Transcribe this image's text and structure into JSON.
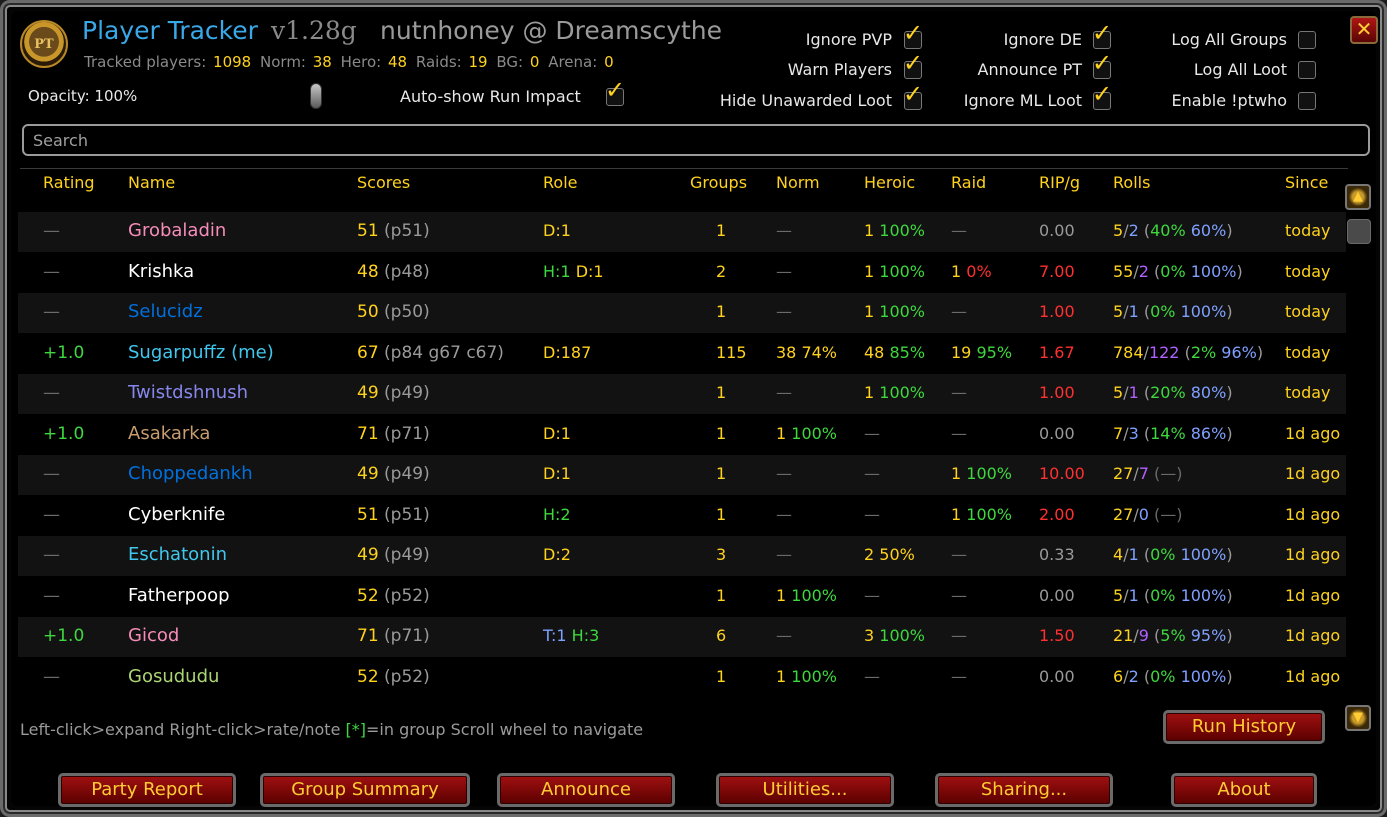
{
  "header": {
    "app_name": "Player Tracker",
    "version": "v1.28g",
    "user": "nutnhoney @ Dreamscythe",
    "logo_text": "PT",
    "stats": {
      "tracked_label": "Tracked players:",
      "tracked": "1098",
      "norm_label": "Norm:",
      "norm": "38",
      "hero_label": "Hero:",
      "hero": "48",
      "raids_label": "Raids:",
      "raids": "19",
      "bg_label": "BG:",
      "bg": "0",
      "arena_label": "Arena:",
      "arena": "0"
    },
    "opacity_label": "Opacity: 100%",
    "autoshow_label": "Auto-show Run Impact",
    "close_glyph": "✕"
  },
  "options": {
    "ignore_pvp": "Ignore PVP",
    "warn_players": "Warn Players",
    "hide_unawarded_loot": "Hide Unawarded Loot",
    "ignore_de": "Ignore DE",
    "announce_pt": "Announce PT",
    "ignore_ml_loot": "Ignore ML Loot",
    "log_all_groups": "Log All Groups",
    "log_all_loot": "Log All Loot",
    "enable_ptwho": "Enable !ptwho"
  },
  "search": {
    "placeholder": "Search"
  },
  "columns": {
    "rating": "Rating",
    "name": "Name",
    "scores": "Scores",
    "role": "Role",
    "groups": "Groups",
    "norm": "Norm",
    "heroic": "Heroic",
    "raid": "Raid",
    "rip": "RIP/g",
    "rolls": "Rolls",
    "since": "Since"
  },
  "colors": {
    "name_pink": "#f58cba",
    "name_white": "#ffffff",
    "name_blue": "#0070de",
    "name_cyan": "#40c7eb",
    "name_purple": "#8787ed",
    "name_tan": "#c79c6e",
    "name_green": "#abd473",
    "gold": "#ffd21e",
    "green": "#3ed83e",
    "red": "#ff3030",
    "blue": "#7fa0ff",
    "purple": "#b060ff"
  },
  "rows": [
    {
      "rating": "—",
      "name": "Grobaladin",
      "name_color": "#f58cba",
      "score": "51",
      "score_detail": "(p51)",
      "role": [
        {
          "t": "D:1",
          "c": "#ffd21e"
        }
      ],
      "groups": "1",
      "norm": [
        {
          "t": "—",
          "c": "#6a6a6a"
        }
      ],
      "heroic": [
        {
          "t": "1 ",
          "c": "#ffd21e"
        },
        {
          "t": "100%",
          "c": "#3ed83e"
        }
      ],
      "raid": [
        {
          "t": "—",
          "c": "#6a6a6a"
        }
      ],
      "rip": "0.00",
      "rip_color": "#9a9a9a",
      "rolls": [
        {
          "t": "5",
          "c": "#ffd21e"
        },
        {
          "t": "/",
          "c": "#9a9a9a"
        },
        {
          "t": "2",
          "c": "#7fa0ff"
        },
        {
          "t": " (",
          "c": "#9a9a9a"
        },
        {
          "t": "40%",
          "c": "#3ed83e"
        },
        {
          "t": " 60%",
          "c": "#7fa0ff"
        },
        {
          "t": ")",
          "c": "#9a9a9a"
        }
      ],
      "since": "today"
    },
    {
      "rating": "—",
      "name": "Krishka",
      "name_color": "#ffffff",
      "score": "48",
      "score_detail": "(p48)",
      "role": [
        {
          "t": "H:1",
          "c": "#3ed83e"
        },
        {
          "t": " D:1",
          "c": "#ffd21e"
        }
      ],
      "groups": "2",
      "norm": [
        {
          "t": "—",
          "c": "#6a6a6a"
        }
      ],
      "heroic": [
        {
          "t": "1 ",
          "c": "#ffd21e"
        },
        {
          "t": "100%",
          "c": "#3ed83e"
        }
      ],
      "raid": [
        {
          "t": "1 ",
          "c": "#ffd21e"
        },
        {
          "t": "0%",
          "c": "#ff3030"
        }
      ],
      "rip": "7.00",
      "rip_color": "#ff3030",
      "rolls": [
        {
          "t": "55",
          "c": "#ffd21e"
        },
        {
          "t": "/",
          "c": "#9a9a9a"
        },
        {
          "t": "2",
          "c": "#b060ff"
        },
        {
          "t": " (",
          "c": "#9a9a9a"
        },
        {
          "t": "0%",
          "c": "#3ed83e"
        },
        {
          "t": " 100%",
          "c": "#7fa0ff"
        },
        {
          "t": ")",
          "c": "#9a9a9a"
        }
      ],
      "since": "today"
    },
    {
      "rating": "—",
      "name": "Selucidz",
      "name_color": "#0070de",
      "score": "50",
      "score_detail": "(p50)",
      "role": [],
      "groups": "1",
      "norm": [
        {
          "t": "—",
          "c": "#6a6a6a"
        }
      ],
      "heroic": [
        {
          "t": "1 ",
          "c": "#ffd21e"
        },
        {
          "t": "100%",
          "c": "#3ed83e"
        }
      ],
      "raid": [
        {
          "t": "—",
          "c": "#6a6a6a"
        }
      ],
      "rip": "1.00",
      "rip_color": "#ff3030",
      "rolls": [
        {
          "t": "5",
          "c": "#ffd21e"
        },
        {
          "t": "/",
          "c": "#9a9a9a"
        },
        {
          "t": "1",
          "c": "#7fa0ff"
        },
        {
          "t": " (",
          "c": "#9a9a9a"
        },
        {
          "t": "0%",
          "c": "#3ed83e"
        },
        {
          "t": " 100%",
          "c": "#7fa0ff"
        },
        {
          "t": ")",
          "c": "#9a9a9a"
        }
      ],
      "since": "today"
    },
    {
      "rating": "+1.0",
      "name": "Sugarpuffz (me)",
      "name_color": "#40c7eb",
      "score": "67",
      "score_detail": "(p84 g67 c67)",
      "role": [
        {
          "t": "D:187",
          "c": "#ffd21e"
        }
      ],
      "groups": "115",
      "norm": [
        {
          "t": "38 74%",
          "c": "#ffd21e"
        }
      ],
      "heroic": [
        {
          "t": "48 ",
          "c": "#ffd21e"
        },
        {
          "t": "85%",
          "c": "#3ed83e"
        }
      ],
      "raid": [
        {
          "t": "19 ",
          "c": "#ffd21e"
        },
        {
          "t": "95%",
          "c": "#3ed83e"
        }
      ],
      "rip": "1.67",
      "rip_color": "#ff3030",
      "rolls": [
        {
          "t": "784",
          "c": "#ffd21e"
        },
        {
          "t": "/",
          "c": "#9a9a9a"
        },
        {
          "t": "122",
          "c": "#b060ff"
        },
        {
          "t": " (",
          "c": "#9a9a9a"
        },
        {
          "t": "2%",
          "c": "#3ed83e"
        },
        {
          "t": " 96%",
          "c": "#7fa0ff"
        },
        {
          "t": ")",
          "c": "#9a9a9a"
        }
      ],
      "since": "today"
    },
    {
      "rating": "—",
      "name": "Twistdshnush",
      "name_color": "#8787ed",
      "score": "49",
      "score_detail": "(p49)",
      "role": [],
      "groups": "1",
      "norm": [
        {
          "t": "—",
          "c": "#6a6a6a"
        }
      ],
      "heroic": [
        {
          "t": "1 ",
          "c": "#ffd21e"
        },
        {
          "t": "100%",
          "c": "#3ed83e"
        }
      ],
      "raid": [
        {
          "t": "—",
          "c": "#6a6a6a"
        }
      ],
      "rip": "1.00",
      "rip_color": "#ff3030",
      "rolls": [
        {
          "t": "5",
          "c": "#ffd21e"
        },
        {
          "t": "/",
          "c": "#9a9a9a"
        },
        {
          "t": "1",
          "c": "#b060ff"
        },
        {
          "t": " (",
          "c": "#9a9a9a"
        },
        {
          "t": "20%",
          "c": "#3ed83e"
        },
        {
          "t": " 80%",
          "c": "#7fa0ff"
        },
        {
          "t": ")",
          "c": "#9a9a9a"
        }
      ],
      "since": "today"
    },
    {
      "rating": "+1.0",
      "name": "Asakarka",
      "name_color": "#c79c6e",
      "score": "71",
      "score_detail": "(p71)",
      "role": [
        {
          "t": "D:1",
          "c": "#ffd21e"
        }
      ],
      "groups": "1",
      "norm": [
        {
          "t": "1 ",
          "c": "#ffd21e"
        },
        {
          "t": "100%",
          "c": "#3ed83e"
        }
      ],
      "heroic": [
        {
          "t": "—",
          "c": "#6a6a6a"
        }
      ],
      "raid": [
        {
          "t": "—",
          "c": "#6a6a6a"
        }
      ],
      "rip": "0.00",
      "rip_color": "#9a9a9a",
      "rolls": [
        {
          "t": "7",
          "c": "#ffd21e"
        },
        {
          "t": "/",
          "c": "#9a9a9a"
        },
        {
          "t": "3",
          "c": "#7fa0ff"
        },
        {
          "t": " (",
          "c": "#9a9a9a"
        },
        {
          "t": "14%",
          "c": "#3ed83e"
        },
        {
          "t": " 86%",
          "c": "#7fa0ff"
        },
        {
          "t": ")",
          "c": "#9a9a9a"
        }
      ],
      "since": "1d ago"
    },
    {
      "rating": "—",
      "name": "Choppedankh",
      "name_color": "#0070de",
      "score": "49",
      "score_detail": "(p49)",
      "role": [
        {
          "t": "D:1",
          "c": "#ffd21e"
        }
      ],
      "groups": "1",
      "norm": [
        {
          "t": "—",
          "c": "#6a6a6a"
        }
      ],
      "heroic": [
        {
          "t": "—",
          "c": "#6a6a6a"
        }
      ],
      "raid": [
        {
          "t": "1 ",
          "c": "#ffd21e"
        },
        {
          "t": "100%",
          "c": "#3ed83e"
        }
      ],
      "rip": "10.00",
      "rip_color": "#ff3030",
      "rolls": [
        {
          "t": "27",
          "c": "#ffd21e"
        },
        {
          "t": "/",
          "c": "#9a9a9a"
        },
        {
          "t": "7",
          "c": "#b060ff"
        },
        {
          "t": " (—)",
          "c": "#6a6a6a"
        }
      ],
      "since": "1d ago"
    },
    {
      "rating": "—",
      "name": "Cyberknife",
      "name_color": "#ffffff",
      "score": "51",
      "score_detail": "(p51)",
      "role": [
        {
          "t": "H:2",
          "c": "#3ed83e"
        }
      ],
      "groups": "1",
      "norm": [
        {
          "t": "—",
          "c": "#6a6a6a"
        }
      ],
      "heroic": [
        {
          "t": "—",
          "c": "#6a6a6a"
        }
      ],
      "raid": [
        {
          "t": "1 ",
          "c": "#ffd21e"
        },
        {
          "t": "100%",
          "c": "#3ed83e"
        }
      ],
      "rip": "2.00",
      "rip_color": "#ff3030",
      "rolls": [
        {
          "t": "27",
          "c": "#ffd21e"
        },
        {
          "t": "/",
          "c": "#9a9a9a"
        },
        {
          "t": "0",
          "c": "#7fa0ff"
        },
        {
          "t": " (—)",
          "c": "#6a6a6a"
        }
      ],
      "since": "1d ago"
    },
    {
      "rating": "—",
      "name": "Eschatonin",
      "name_color": "#40c7eb",
      "score": "49",
      "score_detail": "(p49)",
      "role": [
        {
          "t": "D:2",
          "c": "#ffd21e"
        }
      ],
      "groups": "3",
      "norm": [
        {
          "t": "—",
          "c": "#6a6a6a"
        }
      ],
      "heroic": [
        {
          "t": "2 50%",
          "c": "#ffd21e"
        }
      ],
      "raid": [
        {
          "t": "—",
          "c": "#6a6a6a"
        }
      ],
      "rip": "0.33",
      "rip_color": "#9a9a9a",
      "rolls": [
        {
          "t": "4",
          "c": "#ffd21e"
        },
        {
          "t": "/",
          "c": "#9a9a9a"
        },
        {
          "t": "1",
          "c": "#7fa0ff"
        },
        {
          "t": " (",
          "c": "#9a9a9a"
        },
        {
          "t": "0%",
          "c": "#3ed83e"
        },
        {
          "t": " 100%",
          "c": "#7fa0ff"
        },
        {
          "t": ")",
          "c": "#9a9a9a"
        }
      ],
      "since": "1d ago"
    },
    {
      "rating": "—",
      "name": "Fatherpoop",
      "name_color": "#ffffff",
      "score": "52",
      "score_detail": "(p52)",
      "role": [],
      "groups": "1",
      "norm": [
        {
          "t": "1 ",
          "c": "#ffd21e"
        },
        {
          "t": "100%",
          "c": "#3ed83e"
        }
      ],
      "heroic": [
        {
          "t": "—",
          "c": "#6a6a6a"
        }
      ],
      "raid": [
        {
          "t": "—",
          "c": "#6a6a6a"
        }
      ],
      "rip": "0.00",
      "rip_color": "#9a9a9a",
      "rolls": [
        {
          "t": "5",
          "c": "#ffd21e"
        },
        {
          "t": "/",
          "c": "#9a9a9a"
        },
        {
          "t": "1",
          "c": "#7fa0ff"
        },
        {
          "t": " (",
          "c": "#9a9a9a"
        },
        {
          "t": "0%",
          "c": "#3ed83e"
        },
        {
          "t": " 100%",
          "c": "#7fa0ff"
        },
        {
          "t": ")",
          "c": "#9a9a9a"
        }
      ],
      "since": "1d ago"
    },
    {
      "rating": "+1.0",
      "name": "Gicod",
      "name_color": "#f58cba",
      "score": "71",
      "score_detail": "(p71)",
      "role": [
        {
          "t": "T:1",
          "c": "#7fa0ff"
        },
        {
          "t": " H:3",
          "c": "#3ed83e"
        }
      ],
      "groups": "6",
      "norm": [
        {
          "t": "—",
          "c": "#6a6a6a"
        }
      ],
      "heroic": [
        {
          "t": "3 ",
          "c": "#ffd21e"
        },
        {
          "t": "100%",
          "c": "#3ed83e"
        }
      ],
      "raid": [
        {
          "t": "—",
          "c": "#6a6a6a"
        }
      ],
      "rip": "1.50",
      "rip_color": "#ff3030",
      "rolls": [
        {
          "t": "21",
          "c": "#ffd21e"
        },
        {
          "t": "/",
          "c": "#9a9a9a"
        },
        {
          "t": "9",
          "c": "#b060ff"
        },
        {
          "t": " (",
          "c": "#9a9a9a"
        },
        {
          "t": "5%",
          "c": "#3ed83e"
        },
        {
          "t": " 95%",
          "c": "#7fa0ff"
        },
        {
          "t": ")",
          "c": "#9a9a9a"
        }
      ],
      "since": "1d ago"
    },
    {
      "rating": "—",
      "name": "Gosududu",
      "name_color": "#abd473",
      "score": "52",
      "score_detail": "(p52)",
      "role": [],
      "groups": "1",
      "norm": [
        {
          "t": "1 ",
          "c": "#ffd21e"
        },
        {
          "t": "100%",
          "c": "#3ed83e"
        }
      ],
      "heroic": [
        {
          "t": "—",
          "c": "#6a6a6a"
        }
      ],
      "raid": [
        {
          "t": "—",
          "c": "#6a6a6a"
        }
      ],
      "rip": "0.00",
      "rip_color": "#9a9a9a",
      "rolls": [
        {
          "t": "6",
          "c": "#ffd21e"
        },
        {
          "t": "/",
          "c": "#9a9a9a"
        },
        {
          "t": "2",
          "c": "#7fa0ff"
        },
        {
          "t": " (",
          "c": "#9a9a9a"
        },
        {
          "t": "0%",
          "c": "#3ed83e"
        },
        {
          "t": " 100%",
          "c": "#7fa0ff"
        },
        {
          "t": ")",
          "c": "#9a9a9a"
        }
      ],
      "since": "1d ago"
    }
  ],
  "hint": {
    "part1": "Left-click>expand  Right-click>rate/note  ",
    "part2": "[*]",
    "part3": "=in group  Scroll wheel to navigate"
  },
  "buttons": {
    "run_history": "Run History",
    "party_report": "Party Report",
    "group_summary": "Group Summary",
    "announce": "Announce",
    "utilities": "Utilities...",
    "sharing": "Sharing...",
    "about": "About"
  },
  "icons": {
    "logo": "pt-logo-icon",
    "close": "close-icon",
    "scroll_up": "scroll-up-icon",
    "scroll_down": "scroll-down-icon",
    "check": "checkmark-icon",
    "slider": "slider-knob-icon"
  }
}
